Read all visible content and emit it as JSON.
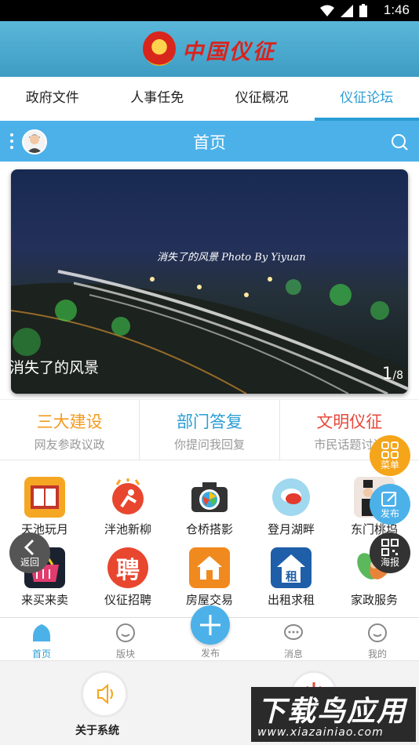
{
  "status_bar": {
    "time": "1:46"
  },
  "app": {
    "title": "中国仪征"
  },
  "tabs": [
    {
      "label": "政府文件",
      "active": false
    },
    {
      "label": "人事任免",
      "active": false
    },
    {
      "label": "仪征概况",
      "active": false
    },
    {
      "label": "仪征论坛",
      "active": true
    }
  ],
  "forum_header": {
    "title": "首页"
  },
  "banner": {
    "caption": "消失了的风景",
    "photo_text": "消失了的风景  Photo By Yiyuan",
    "current": "1",
    "total": "/8"
  },
  "features": [
    {
      "title": "三大建设",
      "subtitle": "网友参政议政",
      "color": "#f39a1e"
    },
    {
      "title": "部门答复",
      "subtitle": "你提问我回复",
      "color": "#2b9dd6"
    },
    {
      "title": "文明仪征",
      "subtitle": "市民话题讨论",
      "color": "#e5473a"
    }
  ],
  "grid": [
    {
      "label": "天池玩月",
      "icon": "book-icon"
    },
    {
      "label": "泮池新柳",
      "icon": "sport-icon"
    },
    {
      "label": "仓桥搭影",
      "icon": "camera-icon"
    },
    {
      "label": "登月湖畔",
      "icon": "chat-bubble-icon"
    },
    {
      "label": "东门桃坞",
      "icon": "wedding-icon"
    },
    {
      "label": "来买来卖",
      "icon": "basket-icon"
    },
    {
      "label": "仪征招聘",
      "icon": "recruit-icon"
    },
    {
      "label": "房屋交易",
      "icon": "house-icon"
    },
    {
      "label": "出租求租",
      "icon": "rent-icon"
    },
    {
      "label": "家政服务",
      "icon": "service-icon"
    }
  ],
  "floating": {
    "menu": "菜单",
    "publish": "发布",
    "poster": "海报",
    "back": "返回"
  },
  "bottom_nav": [
    {
      "label": "首页",
      "active": true
    },
    {
      "label": "版块",
      "active": false
    },
    {
      "label": "发布",
      "active": false
    },
    {
      "label": "消息",
      "active": false
    },
    {
      "label": "我的",
      "active": false
    }
  ],
  "system": {
    "about_label": "关于系统"
  },
  "watermark": {
    "title": "下载鸟应用",
    "url": "www.xiazainiao.com"
  }
}
